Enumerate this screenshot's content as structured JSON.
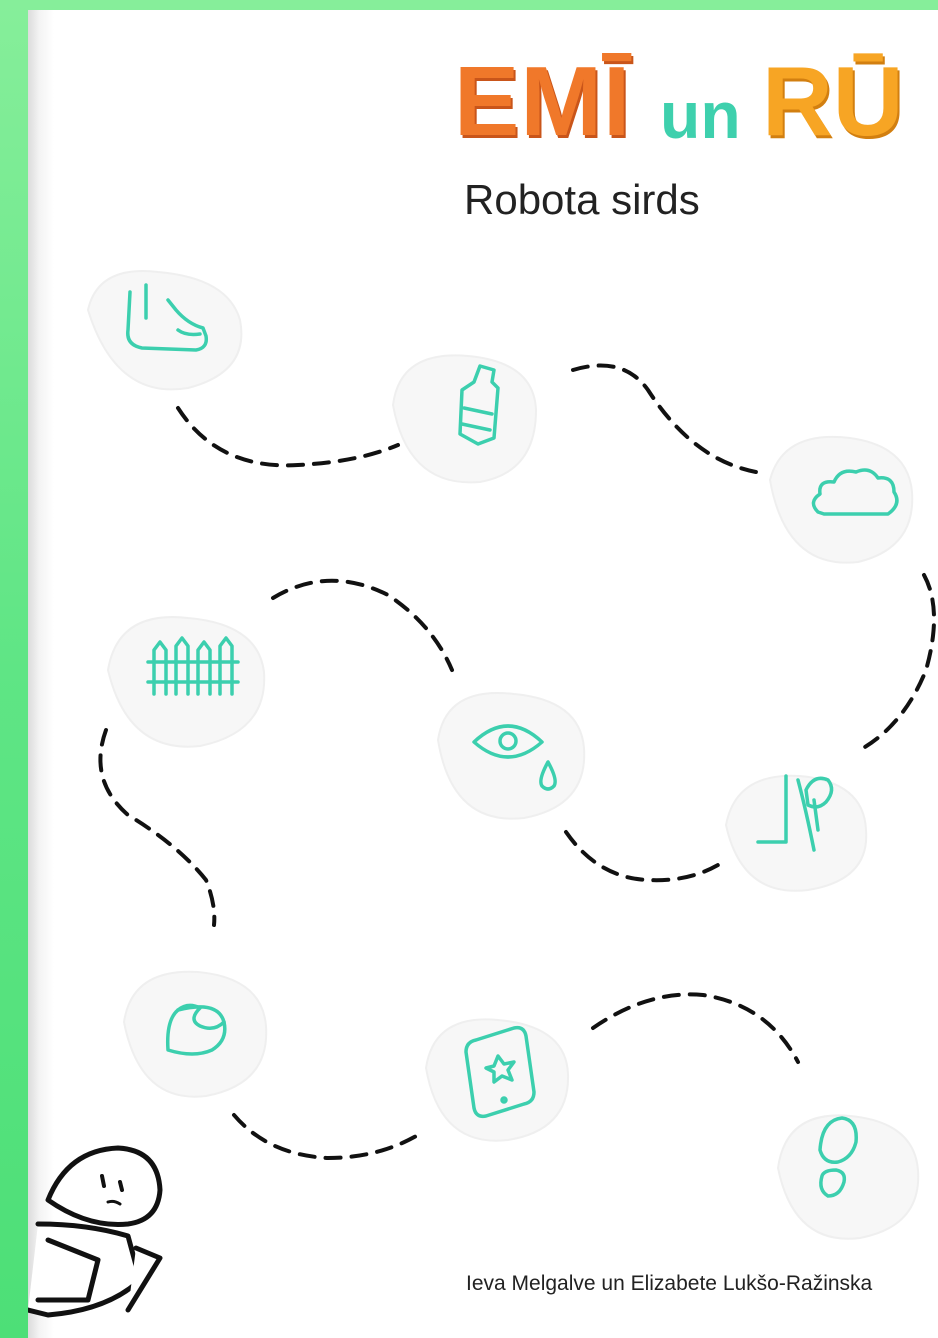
{
  "cover": {
    "logo": {
      "part1": "EMĪ",
      "part2": "un",
      "part3": "RŪ"
    },
    "title": "Robota sirds",
    "authors": "Ieva Melgalve un Elizabete Lukšo-Ražinska"
  },
  "icons": [
    "foot-icon",
    "bottle-icon",
    "cloud-icon",
    "fence-icon",
    "eye-tear-icon",
    "hand-flower-icon",
    "pillow-icon",
    "phone-star-icon",
    "footprint-icon",
    "robot-icon"
  ],
  "colors": {
    "icon_teal": "#3ccfae",
    "logo_orange": "#f0782a",
    "logo_yellow": "#f7a524",
    "background_green": "#5fe585"
  }
}
